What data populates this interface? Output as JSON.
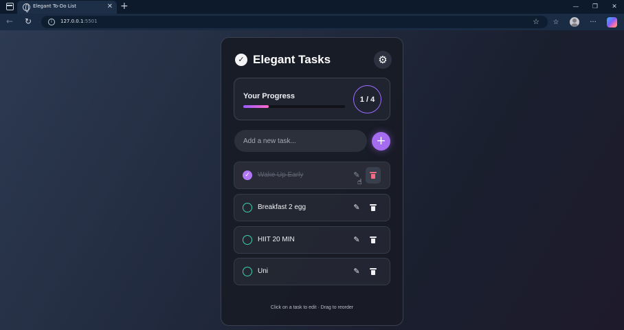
{
  "browser": {
    "tab_title": "Elegant To-Do List",
    "tab_close": "✕",
    "new_tab": "+",
    "url_host": "127.0.0.1",
    "url_port": ":5501",
    "icons": [
      "window-menu-icon",
      "globe-icon",
      "back-icon",
      "refresh-icon",
      "info-icon",
      "star-icon",
      "collections-icon",
      "profile-icon",
      "more-icon",
      "copilot-icon"
    ],
    "win_min": "—",
    "win_max": "❐",
    "win_close": "✕",
    "more": "···"
  },
  "app": {
    "title": "Elegant Tasks",
    "header_check": "✓",
    "settings_icon": "⚙",
    "progress": {
      "label": "Your Progress",
      "completed": 1,
      "total": 4,
      "counter": "1 / 4",
      "fill_fraction": 0.25
    },
    "input_placeholder": "Add a new task...",
    "add_button": "+",
    "tasks": [
      {
        "text": "Wake Up Early",
        "done": true
      },
      {
        "text": "Breakfast 2 egg",
        "done": false
      },
      {
        "text": "HIIT 20 MIN",
        "done": false
      },
      {
        "text": "Uni",
        "done": false
      }
    ],
    "footer": "Click on a task to edit · Drag to reorder",
    "colors": {
      "accent": "#a66cf0",
      "checkbox": "#3fd1ad",
      "delete_hover": "#f06c83"
    }
  }
}
